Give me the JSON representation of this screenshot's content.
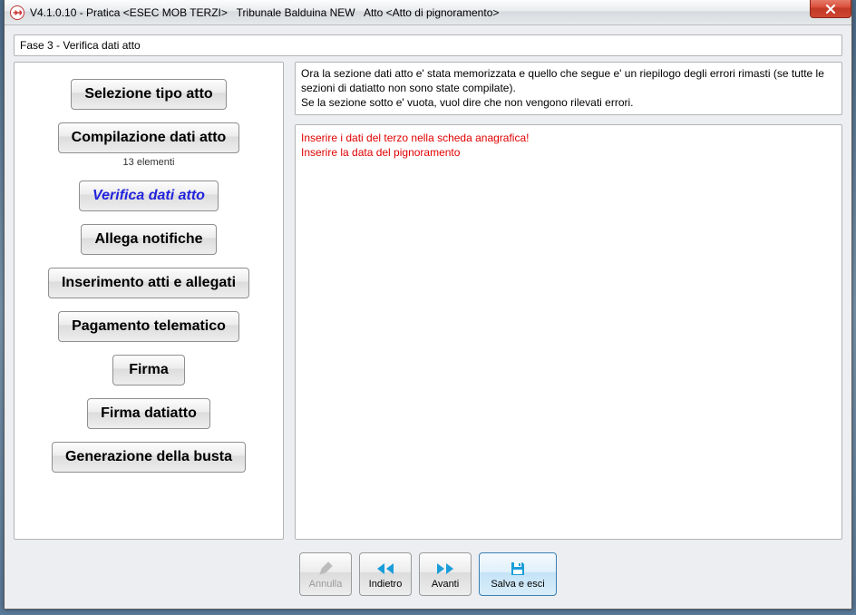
{
  "window": {
    "title": "V4.1.0.10 - Pratica <ESEC MOB TERZI>   Tribunale Balduina NEW   Atto <Atto di pignoramento>"
  },
  "phase_label": "Fase 3 - Verifica dati atto",
  "steps": [
    {
      "key": "selezione",
      "label": "Selezione tipo atto",
      "sub": ""
    },
    {
      "key": "compilazione",
      "label": "Compilazione dati atto",
      "sub": "13 elementi"
    },
    {
      "key": "verifica",
      "label": "Verifica dati atto",
      "sub": "",
      "active": true
    },
    {
      "key": "allega",
      "label": "Allega notifiche",
      "sub": ""
    },
    {
      "key": "inserimento",
      "label": "Inserimento atti e allegati",
      "sub": ""
    },
    {
      "key": "pagamento",
      "label": "Pagamento telematico",
      "sub": ""
    },
    {
      "key": "firma",
      "label": "Firma",
      "sub": ""
    },
    {
      "key": "firma_dati",
      "label": "Firma datiatto",
      "sub": ""
    },
    {
      "key": "generazione",
      "label": "Generazione della busta",
      "sub": ""
    }
  ],
  "info_text": "Ora la sezione dati atto e' stata memorizzata e quello che segue e' un riepilogo degli errori rimasti (se tutte le sezioni di datiatto non sono state compilate).\nSe la sezione sotto e' vuota, vuol dire che non vengono rilevati errori.",
  "errors_text": "Inserire i dati del terzo nella scheda anagrafica!\nInserire la data del pignoramento",
  "footer": {
    "annulla": "Annulla",
    "indietro": "Indietro",
    "avanti": "Avanti",
    "salva": "Salva e esci"
  }
}
